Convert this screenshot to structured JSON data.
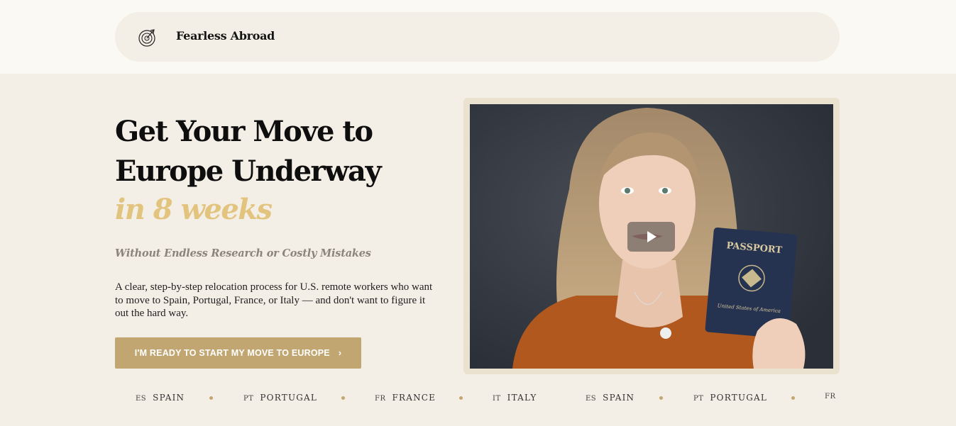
{
  "nav": {
    "brand": "Fearless Abroad",
    "logo_icon": "compass-arrow-icon"
  },
  "hero": {
    "title_line1": "Get Your Move to",
    "title_line2": "Europe Underway",
    "title_accent": "in 8 weeks",
    "subtitle": "Without Endless Research or Costly Mistakes",
    "description": "A clear, step-by-step relocation process for U.S. remote workers who want to move to Spain, Portugal, France, or Italy — and don't want to figure it out the hard way.",
    "cta_label": "I'M READY TO START MY MOVE TO EUROPE",
    "cta_arrow": "›"
  },
  "video": {
    "play_icon": "play-icon",
    "passport_text": "PASSPORT",
    "passport_sub": "United States of America"
  },
  "ticker": [
    {
      "code": "ES",
      "name": "SPAIN"
    },
    {
      "code": "PT",
      "name": "PORTUGAL"
    },
    {
      "code": "FR",
      "name": "FRANCE"
    },
    {
      "code": "IT",
      "name": "ITALY"
    },
    {
      "code": "ES",
      "name": "SPAIN"
    },
    {
      "code": "PT",
      "name": "PORTUGAL"
    },
    {
      "code": "FR",
      "name": ""
    }
  ],
  "colors": {
    "accent_gold": "#e2c47f",
    "button": "#c2a671",
    "background": "#f4efe6"
  }
}
